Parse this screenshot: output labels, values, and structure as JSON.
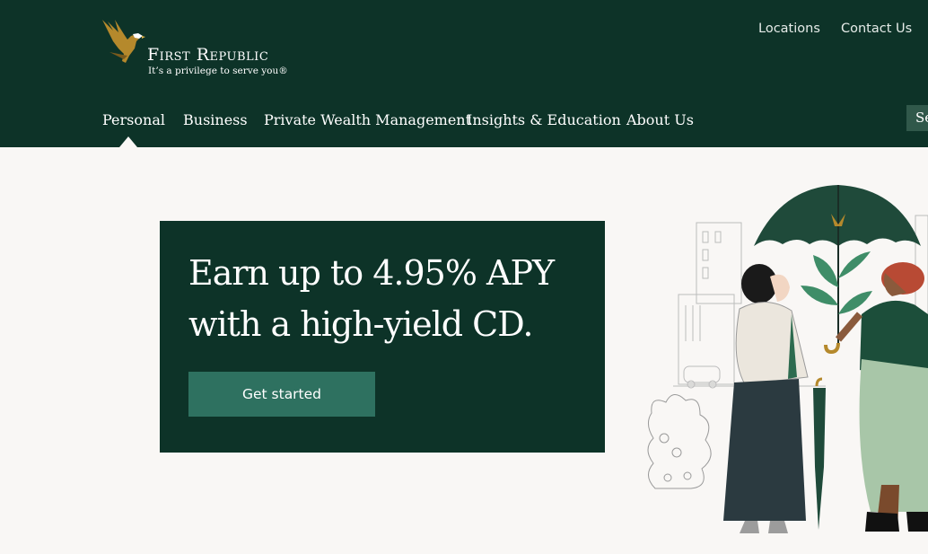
{
  "brand": {
    "name": "First Republic",
    "tagline": "It’s a privilege to serve you®"
  },
  "utility_nav": {
    "locations": "Locations",
    "contact": "Contact Us"
  },
  "main_nav": {
    "items": [
      {
        "label": "Personal",
        "active": true
      },
      {
        "label": "Business"
      },
      {
        "label": "Private Wealth Management"
      },
      {
        "label": "Insights & Education"
      },
      {
        "label": "About Us"
      }
    ],
    "search_stub": "Se"
  },
  "hero": {
    "headline": "Earn up to 4.95% APY with a high-yield CD.",
    "cta_label": "Get started",
    "illustration_icon": "women-under-umbrella-illustration"
  },
  "colors": {
    "header_bg": "#0d3328",
    "page_bg": "#f9f7f5",
    "cta_bg": "#2e7160",
    "eagle_gold": "#b5892c"
  }
}
